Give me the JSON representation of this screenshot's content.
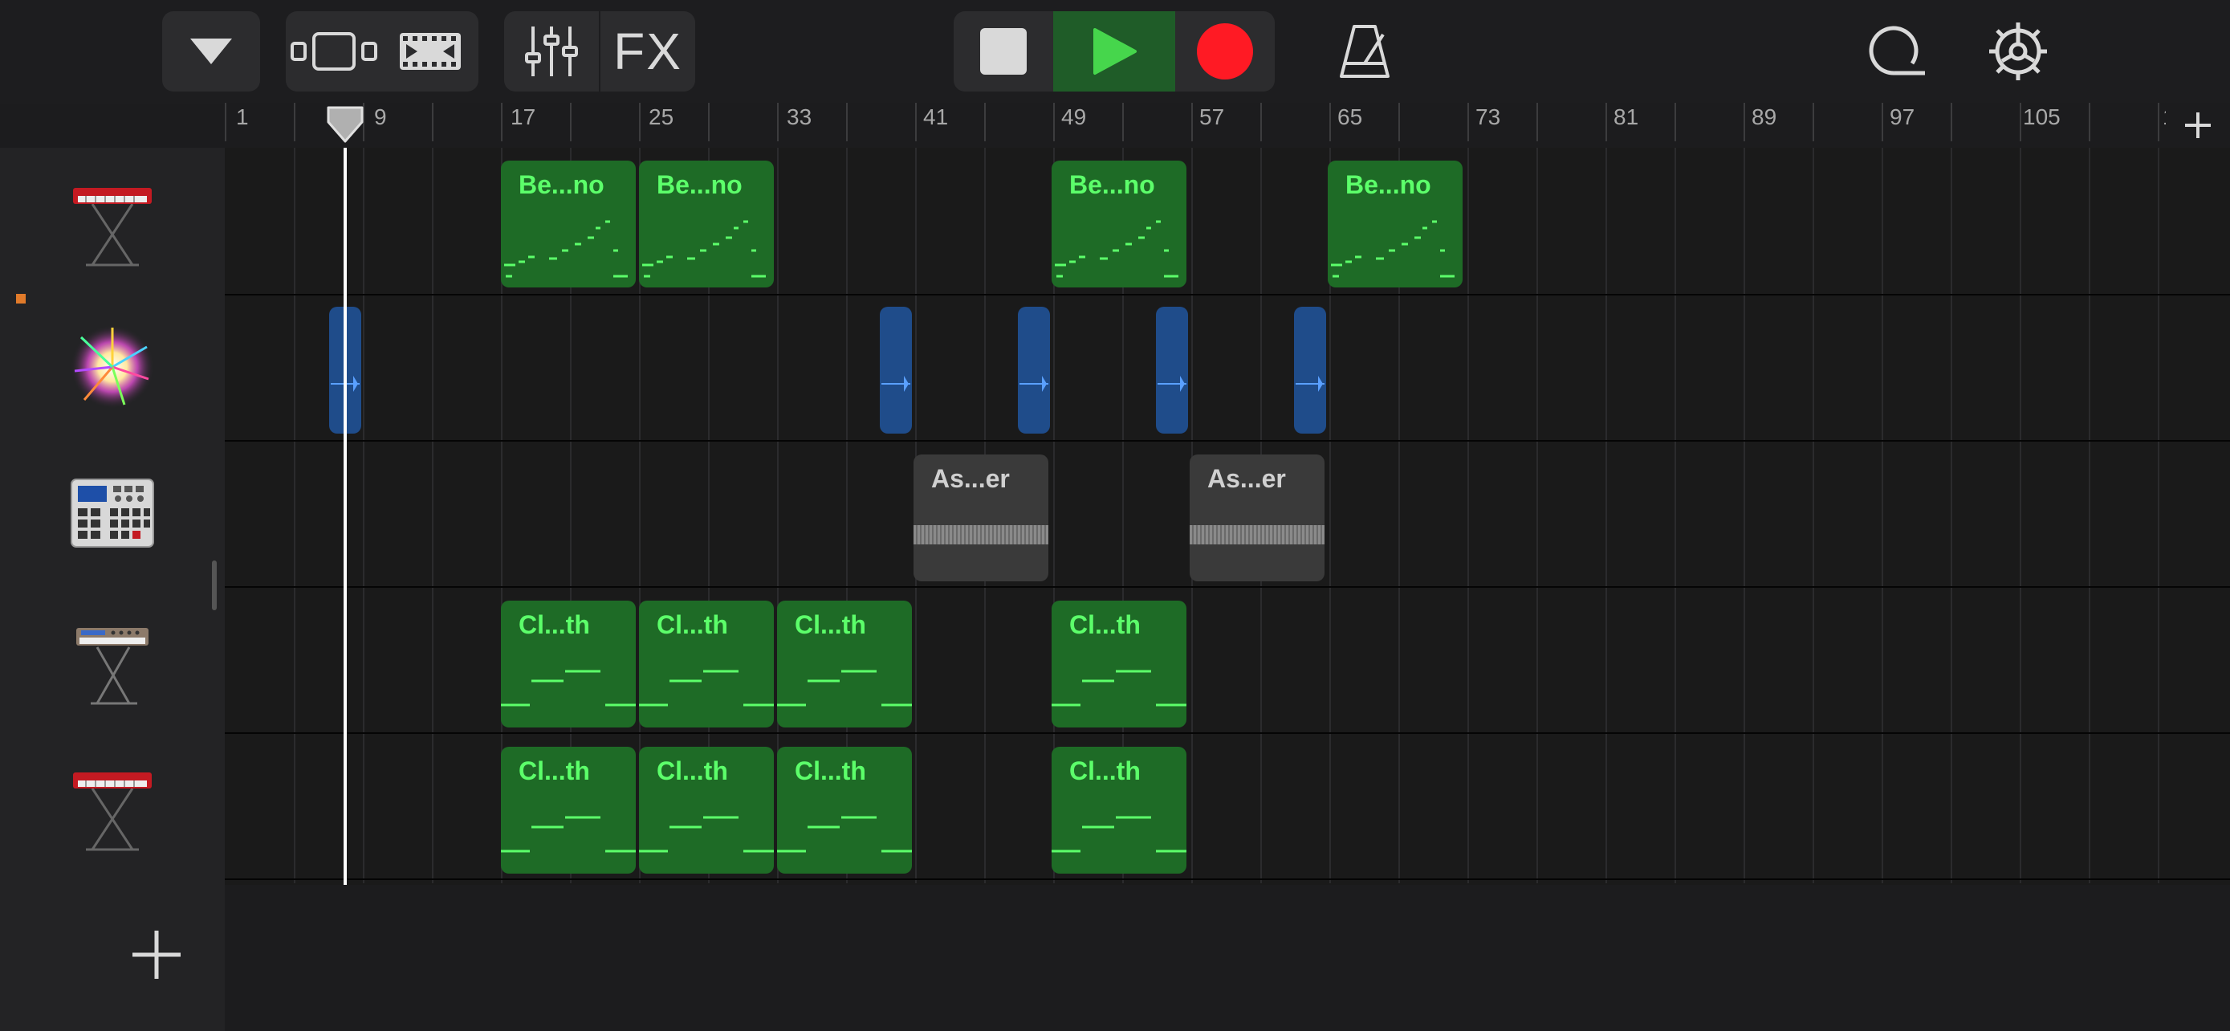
{
  "toolbar": {
    "fx_label": "FX",
    "colors": {
      "play_active_bg": "#1f5c28",
      "play_icon": "#46d64c",
      "record": "#ff1a24"
    }
  },
  "ruler": {
    "bar_numbers": [
      "1",
      "9",
      "17",
      "25",
      "33",
      "41",
      "49",
      "57",
      "65",
      "73",
      "81",
      "89",
      "97",
      "105",
      "1"
    ]
  },
  "tracks": [
    {
      "instrument": "red-keyboard",
      "regions": [
        {
          "label": "Be...no"
        },
        {
          "label": "Be...no"
        },
        {
          "label": "Be...no"
        },
        {
          "label": "Be...no"
        }
      ]
    },
    {
      "instrument": "sparkle-fx",
      "regions": []
    },
    {
      "instrument": "drum-machine",
      "regions": [
        {
          "label": "As...er"
        },
        {
          "label": "As...er"
        }
      ]
    },
    {
      "instrument": "synth-keyboard",
      "regions": [
        {
          "label": "Cl...th"
        },
        {
          "label": "Cl...th"
        },
        {
          "label": "Cl...th"
        },
        {
          "label": "Cl...th"
        }
      ]
    },
    {
      "instrument": "red-keyboard",
      "regions": [
        {
          "label": "Cl...th"
        },
        {
          "label": "Cl...th"
        },
        {
          "label": "Cl...th"
        },
        {
          "label": "Cl...th"
        }
      ]
    }
  ]
}
